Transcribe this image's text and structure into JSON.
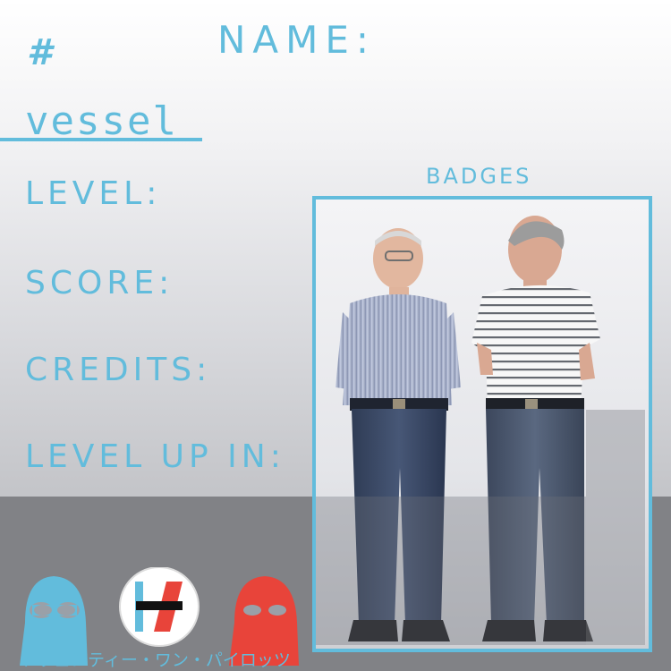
{
  "profile": {
    "hash_symbol": "#",
    "name_label": "NAME:",
    "username": "vessel"
  },
  "stats": {
    "level_label": "LEVEL:",
    "score_label": "SCORE:",
    "credits_label": "CREDITS:",
    "level_up_label": "LEVEL UP IN:"
  },
  "badges": {
    "title": "BADGES"
  },
  "footer": {
    "tagline": "トウェンティー・ワン・パイロッツ"
  },
  "colors": {
    "accent": "#62bcdc",
    "red": "#e8443a",
    "band": "#818286"
  },
  "icons": [
    "blue-mask-icon",
    "band-logo-icon",
    "red-mask-icon"
  ]
}
